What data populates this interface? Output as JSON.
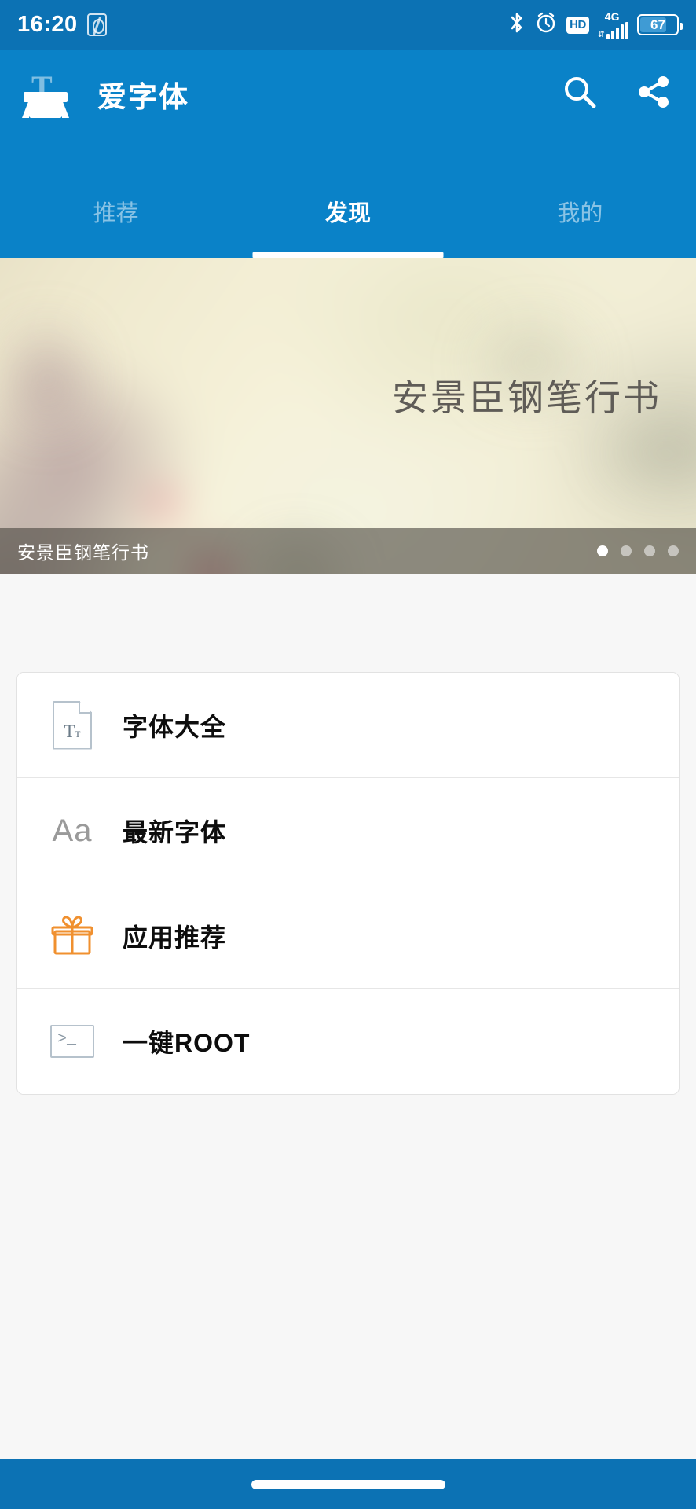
{
  "status_bar": {
    "time": "16:20",
    "app_notification_icon": "fingerprint-app-icon",
    "icons": [
      {
        "name": "bluetooth-icon",
        "label": "Bluetooth"
      },
      {
        "name": "alarm-clock-icon",
        "label": "Alarm"
      },
      {
        "name": "hd-icon",
        "label": "HD"
      },
      {
        "name": "network-type-icon",
        "label": "4G"
      },
      {
        "name": "signal-bars-icon",
        "label": "signal"
      },
      {
        "name": "battery-icon",
        "label": "battery"
      }
    ],
    "network_type": "4G",
    "battery_percent": "67",
    "battery_fill_pct": 67
  },
  "app_bar": {
    "logo_icon": "ifont-logo-icon",
    "logo_letter": "T",
    "title": "爱字体",
    "search_label": "search-icon",
    "share_label": "share-icon"
  },
  "tabs": {
    "items": [
      {
        "label": "推荐",
        "active": false
      },
      {
        "label": "发现",
        "active": true
      },
      {
        "label": "我的",
        "active": false
      }
    ]
  },
  "banner": {
    "font_preview_text": "安景臣钢笔行书",
    "caption": "安景臣钢笔行书",
    "dot_count": 4,
    "active_dot": 0,
    "text_color": "#5f5c57"
  },
  "menu": {
    "items": [
      {
        "label": "字体大全",
        "icon": "font-document-icon",
        "icon_text": "Tт"
      },
      {
        "label": "最新字体",
        "icon": "aa-letters-icon",
        "icon_text": "Aa"
      },
      {
        "label": "应用推荐",
        "icon": "gift-box-icon",
        "icon_text": ""
      },
      {
        "label": "一键ROOT",
        "icon": "terminal-icon",
        "icon_text": ">_"
      }
    ]
  },
  "navbar": {
    "home_indicator": "home-gesture-pill"
  },
  "colors": {
    "status_bar_bg": "#0c72b4",
    "app_bar_bg": "#0a82c8",
    "page_bg": "#f7f7f7",
    "card_bg": "#ffffff",
    "accent_orange": "#f0902f",
    "icon_gray": "#b6c2cc"
  }
}
